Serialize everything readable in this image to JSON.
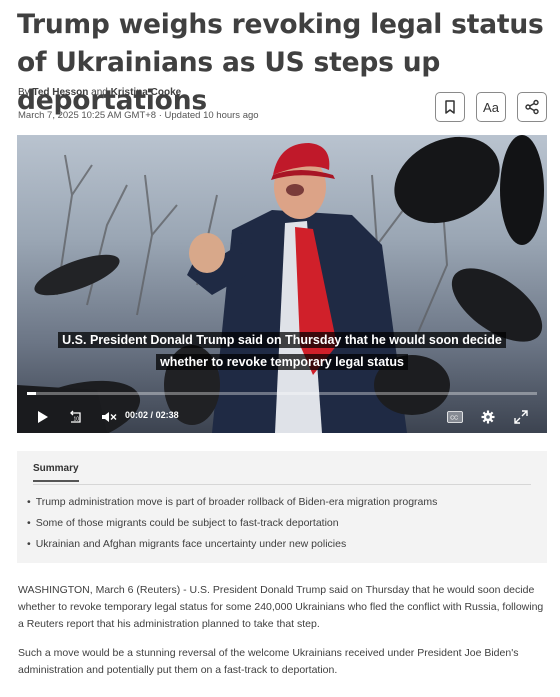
{
  "article": {
    "headline": "Trump weighs revoking legal status of Ukrainians as US steps up deportations",
    "byline_prefix": "By",
    "author1": "Ted Hesson",
    "byline_and": "and",
    "author2": "Kristina Cooke",
    "dateline": "March 7, 2025 10:25 AM GMT+8 · Updated 10 hours ago"
  },
  "toolbar": {
    "bookmark_icon": "bookmark-icon",
    "font_label": "Aa",
    "share_icon": "share-icon"
  },
  "video": {
    "caption_line1": "U.S. President Donald Trump said on Thursday that he would soon decide",
    "caption_line2": "whether to revoke temporary legal status",
    "current_time": "00:02",
    "time_separator": "/",
    "duration": "02:38",
    "progress_fraction": 0.017,
    "cc_label": "CC",
    "colors": {
      "tie": "#d0202a",
      "cap": "#c0192a",
      "suit": "#1f2a44"
    }
  },
  "summary": {
    "tab_label": "Summary",
    "items": [
      "Trump administration move is part of broader rollback of Biden-era migration programs",
      "Some of those migrants could be subject to fast-track deportation",
      "Ukrainian and Afghan migrants face uncertainty under new policies"
    ]
  },
  "body": {
    "paragraph1": "WASHINGTON, March 6 (Reuters) - U.S. President Donald Trump said on Thursday that he would soon decide whether to revoke temporary legal status for some 240,000 Ukrainians who fled the conflict with Russia, following a Reuters report that his administration planned to take that step.",
    "paragraph2": "Such a move would be a stunning reversal of the welcome Ukrainians received under President Joe Biden's administration and potentially put them on a fast-track to deportation."
  }
}
